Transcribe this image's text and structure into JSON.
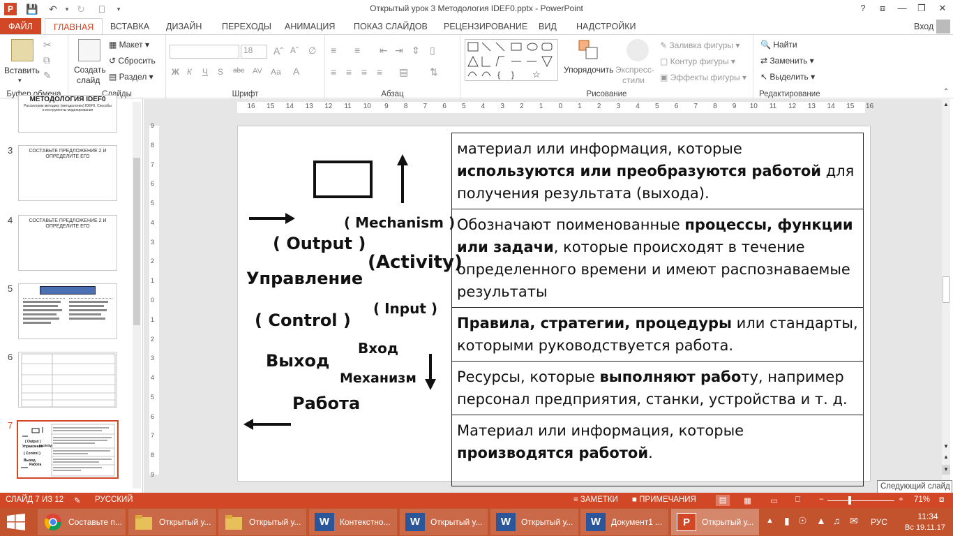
{
  "window": {
    "title": "Открытый урок 3 Методология IDEF0.pptx - PowerPoint",
    "help": "?",
    "signin": "Вход"
  },
  "tabs": [
    "ФАЙЛ",
    "ГЛАВНАЯ",
    "ВСТАВКА",
    "ДИЗАЙН",
    "ПЕРЕХОДЫ",
    "АНИМАЦИЯ",
    "ПОКАЗ СЛАЙДОВ",
    "РЕЦЕНЗИРОВАНИЕ",
    "ВИД",
    "НАДСТРОЙКИ"
  ],
  "ribbon": {
    "clipboard": {
      "label": "Буфер обмена",
      "paste": "Вставить"
    },
    "slides": {
      "label": "Слайды",
      "new_slide_1": "Создать",
      "new_slide_2": "слайд",
      "layout": "Макет",
      "reset": "Сбросить",
      "section": "Раздел"
    },
    "font": {
      "label": "Шрифт",
      "font_size": "18",
      "bold": "Ж",
      "italic": "К",
      "underline": "Ч",
      "strike": "S",
      "spacing": "abc",
      "case": "Аа",
      "color": "A"
    },
    "paragraph": {
      "label": "Абзац"
    },
    "drawing": {
      "label": "Рисование",
      "arrange": "Упорядочить",
      "quick_styles_1": "Экспресс-",
      "quick_styles_2": "стили",
      "fill": "Заливка фигуры",
      "outline": "Контур фигуры",
      "effects": "Эффекты фигуры"
    },
    "editing": {
      "label": "Редактирование",
      "find": "Найти",
      "replace": "Заменить",
      "select": "Выделить"
    }
  },
  "thumbnails": [
    {
      "num": "",
      "title": "МЕТОДОЛОГИЯ IDEF0",
      "subtitle": "Рассмотрим методику (методологию) IDEF0. Способы и инструменты моделирования"
    },
    {
      "num": "3",
      "title": "СОСТАВЬТЕ ПРЕДЛОЖЕНИЕ 2 И ОПРЕДЕЛИТЕ ЕГО"
    },
    {
      "num": "4",
      "title": "СОСТАВЬТЕ ПРЕДЛОЖЕНИЕ 2 И ОПРЕДЕЛИТЕ ЕГО"
    },
    {
      "num": "5"
    },
    {
      "num": "6"
    },
    {
      "num": "7"
    }
  ],
  "ruler": {
    "h": [
      "16",
      "15",
      "14",
      "13",
      "12",
      "11",
      "10",
      "9",
      "8",
      "7",
      "6",
      "5",
      "4",
      "3",
      "2",
      "1",
      "0",
      "1",
      "2",
      "3",
      "4",
      "5",
      "6",
      "7",
      "8",
      "9",
      "10",
      "11",
      "12",
      "13",
      "14",
      "15",
      "16"
    ],
    "v": [
      "9",
      "8",
      "7",
      "6",
      "5",
      "4",
      "3",
      "2",
      "1",
      "0",
      "1",
      "2",
      "3",
      "4",
      "5",
      "6",
      "7",
      "8",
      "9"
    ]
  },
  "slide": {
    "labels": {
      "mechanism_en": "( Mechanism )",
      "output_en": "( Output )",
      "activity_en": "(Activity)",
      "control_ru": "Управление",
      "input_en": "( Input )",
      "control_en": "( Control )",
      "input_ru": "Вход",
      "output_ru": "Выход",
      "mechanism_ru": "Механизм",
      "activity_ru": "Работа"
    },
    "rows": [
      {
        "a": "материал или информация, которые ",
        "b": "используются или преобразуются работой",
        "c": " для получения результата (выхода)."
      },
      {
        "a": "Обозначают поименованные ",
        "b": "процессы, функции или задачи",
        "c": ", которые происходят в течение определенного времени и имеют распознаваемые результаты"
      },
      {
        "a": "",
        "b": "Правила, стратегии, процедуры",
        "c": " или стандарты, которыми руководствуется работа."
      },
      {
        "a": "Ресурсы, которые ",
        "b": "выполняют рабо",
        "c": "ту, например персонал предприятия, станки, устройства и т. д."
      },
      {
        "a": "Материал или информация, которые ",
        "b": "производятся работой",
        "c": "."
      }
    ]
  },
  "tooltip": "Следующий слайд",
  "status": {
    "slide": "СЛАЙД 7 ИЗ 12",
    "lang": "РУССКИЙ",
    "notes": "ЗАМЕТКИ",
    "comments": "ПРИМЕЧАНИЯ",
    "zoom": "71%"
  },
  "taskbar": {
    "items": [
      "Составьте п...",
      "Открытый у...",
      "Открытый у...",
      "Контекстно...",
      "Открытый у...",
      "Открытый у...",
      "Документ1 ...",
      "Открытый у..."
    ],
    "lang": "РУС",
    "time": "11:34",
    "date": "Вс 19.11.17"
  },
  "colors": {
    "accent": "#d24726",
    "taskbar": "#c3532c",
    "word": "#2b579a"
  }
}
